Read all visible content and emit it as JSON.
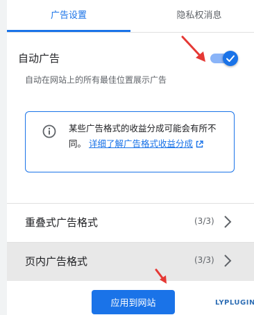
{
  "tabs": [
    {
      "label": "广告设置",
      "active": true
    },
    {
      "label": "隐私权消息",
      "active": false
    }
  ],
  "auto_ads": {
    "title": "自动广告",
    "description": "自动在网站上的所有最佳位置展示广告",
    "toggle_on": true
  },
  "info_box": {
    "icon": "info-icon",
    "text": "某些广告格式的收益分成可能会有所不同。",
    "link": "详细了解广告格式收益分成",
    "link_icon": "open-in-new-icon"
  },
  "formats": [
    {
      "label": "重叠式广告格式",
      "count": "(3/3)"
    },
    {
      "label": "页内广告格式",
      "count": "(3/3)"
    }
  ],
  "footer": {
    "apply_label": "应用到网站"
  },
  "watermark": "LYPLUGIN",
  "colors": {
    "accent": "#1a73e8",
    "annotation_arrow": "#e53935",
    "hover_row": "#e8e8e8"
  }
}
